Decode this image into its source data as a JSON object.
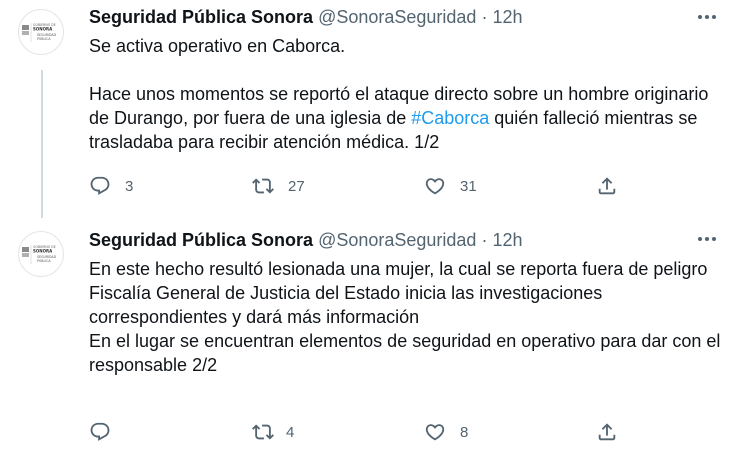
{
  "tweets": [
    {
      "name": "Seguridad Pública Sonora",
      "handle": "@SonoraSeguridad",
      "separator": "·",
      "time": "12h",
      "text_before": "Se activa operativo en Caborca.\n\nHace unos momentos se reportó el ataque directo sobre un hombre originario de Durango, por fuera de una iglesia de ",
      "hashtag": "#Caborca",
      "text_after": " quién falleció mientras se trasladaba para recibir atención médica. 1/2",
      "replies": "3",
      "retweets": "27",
      "likes": "31"
    },
    {
      "name": "Seguridad Pública Sonora",
      "handle": "@SonoraSeguridad",
      "separator": "·",
      "time": "12h",
      "text": "En este hecho resultó lesionada una mujer, la cual se reporta fuera de peligro\nFiscalía General de Justicia del Estado inicia las investigaciones correspondientes y dará más información\nEn el lugar se encuentran elementos de seguridad en operativo para dar con el responsable 2/2",
      "replies": "",
      "retweets": "4",
      "likes": "8"
    }
  ],
  "avatar": {
    "line1": "GOBIERNO DE",
    "line2": "SONORA",
    "line3": "SEGURIDAD",
    "line4": "PÚBLICA"
  },
  "icons": {
    "reply": "reply-icon",
    "retweet": "retweet-icon",
    "like": "heart-icon",
    "share": "share-icon",
    "more": "more-icon"
  },
  "colors": {
    "text": "#0f1419",
    "muted": "#536471",
    "link": "#1d9bf0",
    "thread": "#cfd9de"
  }
}
